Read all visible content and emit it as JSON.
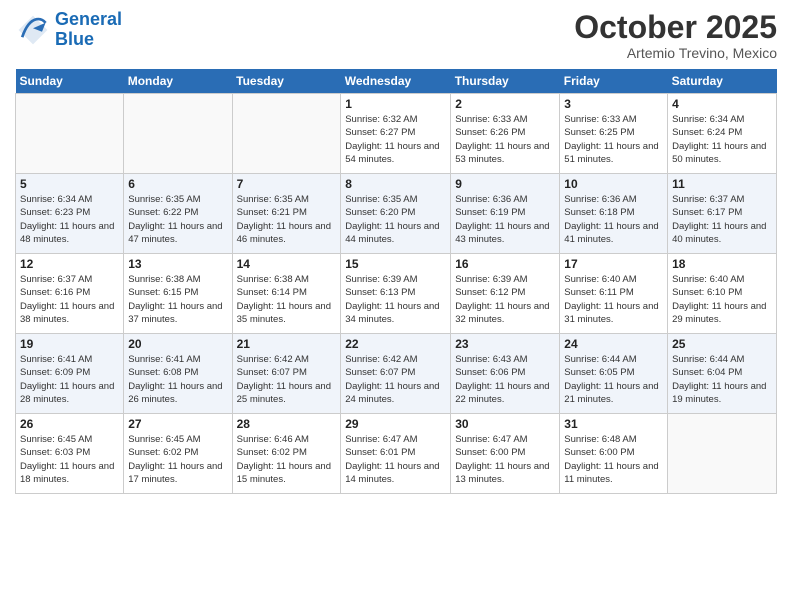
{
  "logo": {
    "line1": "General",
    "line2": "Blue"
  },
  "title": "October 2025",
  "subtitle": "Artemio Trevino, Mexico",
  "weekdays": [
    "Sunday",
    "Monday",
    "Tuesday",
    "Wednesday",
    "Thursday",
    "Friday",
    "Saturday"
  ],
  "weeks": [
    [
      {
        "day": "",
        "sunrise": "",
        "sunset": "",
        "daylight": ""
      },
      {
        "day": "",
        "sunrise": "",
        "sunset": "",
        "daylight": ""
      },
      {
        "day": "",
        "sunrise": "",
        "sunset": "",
        "daylight": ""
      },
      {
        "day": "1",
        "sunrise": "Sunrise: 6:32 AM",
        "sunset": "Sunset: 6:27 PM",
        "daylight": "Daylight: 11 hours and 54 minutes."
      },
      {
        "day": "2",
        "sunrise": "Sunrise: 6:33 AM",
        "sunset": "Sunset: 6:26 PM",
        "daylight": "Daylight: 11 hours and 53 minutes."
      },
      {
        "day": "3",
        "sunrise": "Sunrise: 6:33 AM",
        "sunset": "Sunset: 6:25 PM",
        "daylight": "Daylight: 11 hours and 51 minutes."
      },
      {
        "day": "4",
        "sunrise": "Sunrise: 6:34 AM",
        "sunset": "Sunset: 6:24 PM",
        "daylight": "Daylight: 11 hours and 50 minutes."
      }
    ],
    [
      {
        "day": "5",
        "sunrise": "Sunrise: 6:34 AM",
        "sunset": "Sunset: 6:23 PM",
        "daylight": "Daylight: 11 hours and 48 minutes."
      },
      {
        "day": "6",
        "sunrise": "Sunrise: 6:35 AM",
        "sunset": "Sunset: 6:22 PM",
        "daylight": "Daylight: 11 hours and 47 minutes."
      },
      {
        "day": "7",
        "sunrise": "Sunrise: 6:35 AM",
        "sunset": "Sunset: 6:21 PM",
        "daylight": "Daylight: 11 hours and 46 minutes."
      },
      {
        "day": "8",
        "sunrise": "Sunrise: 6:35 AM",
        "sunset": "Sunset: 6:20 PM",
        "daylight": "Daylight: 11 hours and 44 minutes."
      },
      {
        "day": "9",
        "sunrise": "Sunrise: 6:36 AM",
        "sunset": "Sunset: 6:19 PM",
        "daylight": "Daylight: 11 hours and 43 minutes."
      },
      {
        "day": "10",
        "sunrise": "Sunrise: 6:36 AM",
        "sunset": "Sunset: 6:18 PM",
        "daylight": "Daylight: 11 hours and 41 minutes."
      },
      {
        "day": "11",
        "sunrise": "Sunrise: 6:37 AM",
        "sunset": "Sunset: 6:17 PM",
        "daylight": "Daylight: 11 hours and 40 minutes."
      }
    ],
    [
      {
        "day": "12",
        "sunrise": "Sunrise: 6:37 AM",
        "sunset": "Sunset: 6:16 PM",
        "daylight": "Daylight: 11 hours and 38 minutes."
      },
      {
        "day": "13",
        "sunrise": "Sunrise: 6:38 AM",
        "sunset": "Sunset: 6:15 PM",
        "daylight": "Daylight: 11 hours and 37 minutes."
      },
      {
        "day": "14",
        "sunrise": "Sunrise: 6:38 AM",
        "sunset": "Sunset: 6:14 PM",
        "daylight": "Daylight: 11 hours and 35 minutes."
      },
      {
        "day": "15",
        "sunrise": "Sunrise: 6:39 AM",
        "sunset": "Sunset: 6:13 PM",
        "daylight": "Daylight: 11 hours and 34 minutes."
      },
      {
        "day": "16",
        "sunrise": "Sunrise: 6:39 AM",
        "sunset": "Sunset: 6:12 PM",
        "daylight": "Daylight: 11 hours and 32 minutes."
      },
      {
        "day": "17",
        "sunrise": "Sunrise: 6:40 AM",
        "sunset": "Sunset: 6:11 PM",
        "daylight": "Daylight: 11 hours and 31 minutes."
      },
      {
        "day": "18",
        "sunrise": "Sunrise: 6:40 AM",
        "sunset": "Sunset: 6:10 PM",
        "daylight": "Daylight: 11 hours and 29 minutes."
      }
    ],
    [
      {
        "day": "19",
        "sunrise": "Sunrise: 6:41 AM",
        "sunset": "Sunset: 6:09 PM",
        "daylight": "Daylight: 11 hours and 28 minutes."
      },
      {
        "day": "20",
        "sunrise": "Sunrise: 6:41 AM",
        "sunset": "Sunset: 6:08 PM",
        "daylight": "Daylight: 11 hours and 26 minutes."
      },
      {
        "day": "21",
        "sunrise": "Sunrise: 6:42 AM",
        "sunset": "Sunset: 6:07 PM",
        "daylight": "Daylight: 11 hours and 25 minutes."
      },
      {
        "day": "22",
        "sunrise": "Sunrise: 6:42 AM",
        "sunset": "Sunset: 6:07 PM",
        "daylight": "Daylight: 11 hours and 24 minutes."
      },
      {
        "day": "23",
        "sunrise": "Sunrise: 6:43 AM",
        "sunset": "Sunset: 6:06 PM",
        "daylight": "Daylight: 11 hours and 22 minutes."
      },
      {
        "day": "24",
        "sunrise": "Sunrise: 6:44 AM",
        "sunset": "Sunset: 6:05 PM",
        "daylight": "Daylight: 11 hours and 21 minutes."
      },
      {
        "day": "25",
        "sunrise": "Sunrise: 6:44 AM",
        "sunset": "Sunset: 6:04 PM",
        "daylight": "Daylight: 11 hours and 19 minutes."
      }
    ],
    [
      {
        "day": "26",
        "sunrise": "Sunrise: 6:45 AM",
        "sunset": "Sunset: 6:03 PM",
        "daylight": "Daylight: 11 hours and 18 minutes."
      },
      {
        "day": "27",
        "sunrise": "Sunrise: 6:45 AM",
        "sunset": "Sunset: 6:02 PM",
        "daylight": "Daylight: 11 hours and 17 minutes."
      },
      {
        "day": "28",
        "sunrise": "Sunrise: 6:46 AM",
        "sunset": "Sunset: 6:02 PM",
        "daylight": "Daylight: 11 hours and 15 minutes."
      },
      {
        "day": "29",
        "sunrise": "Sunrise: 6:47 AM",
        "sunset": "Sunset: 6:01 PM",
        "daylight": "Daylight: 11 hours and 14 minutes."
      },
      {
        "day": "30",
        "sunrise": "Sunrise: 6:47 AM",
        "sunset": "Sunset: 6:00 PM",
        "daylight": "Daylight: 11 hours and 13 minutes."
      },
      {
        "day": "31",
        "sunrise": "Sunrise: 6:48 AM",
        "sunset": "Sunset: 6:00 PM",
        "daylight": "Daylight: 11 hours and 11 minutes."
      },
      {
        "day": "",
        "sunrise": "",
        "sunset": "",
        "daylight": ""
      }
    ]
  ]
}
